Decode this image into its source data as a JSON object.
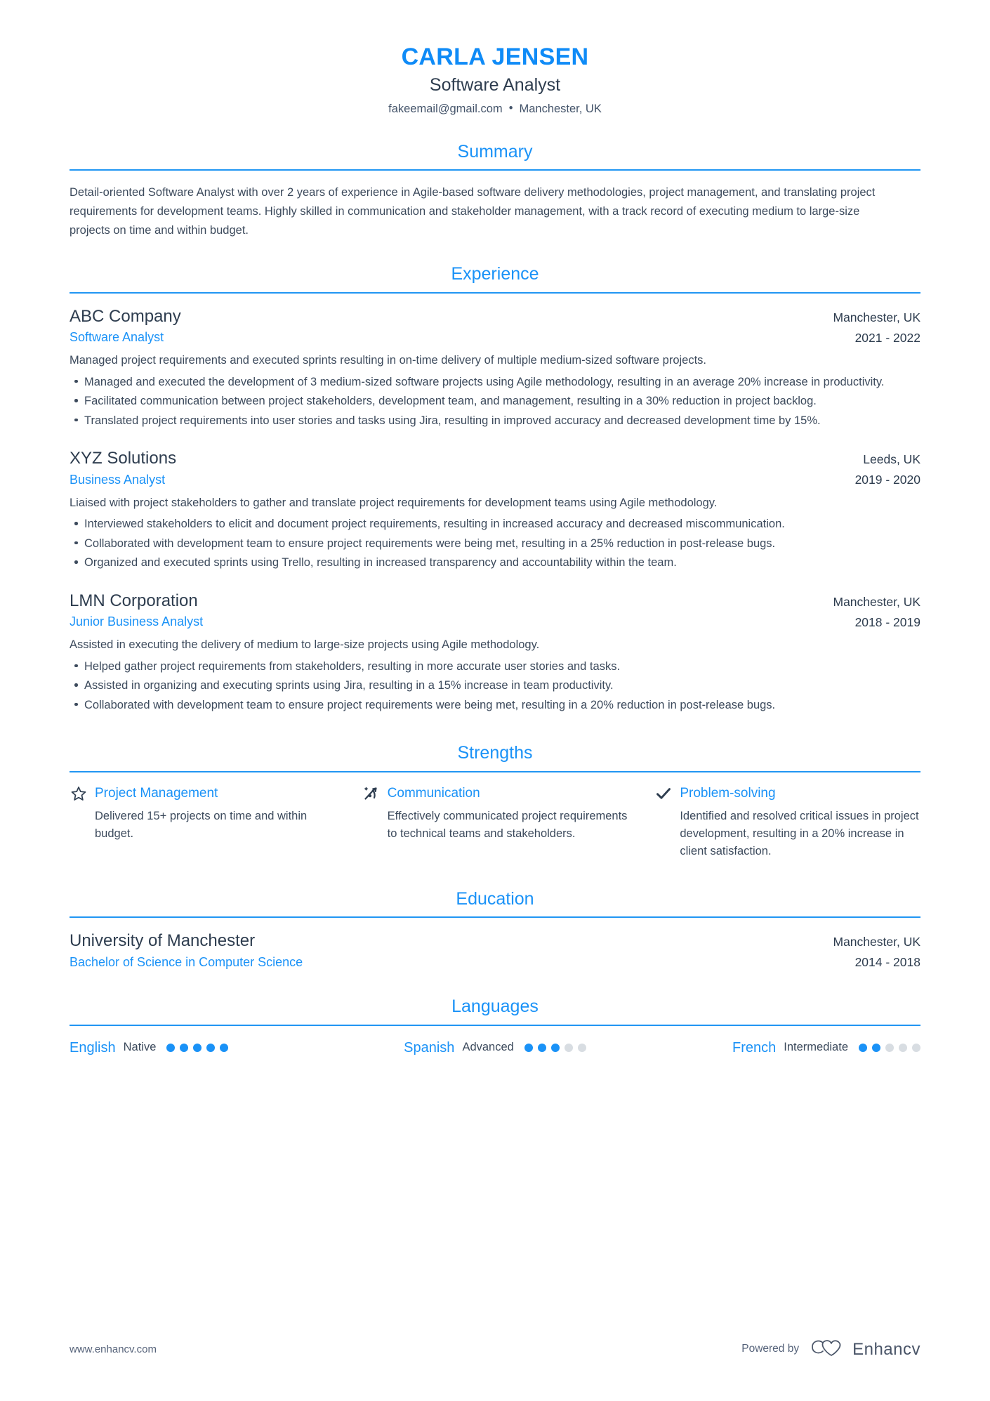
{
  "theme": {
    "accent": "#1a92f7",
    "name_color": "#0f8bf7",
    "text_dark": "#2e3d4f",
    "text_body": "#3c4a5c",
    "rule_color": "#2196f3",
    "dot_empty": "#d8dde2"
  },
  "header": {
    "full_name": "CARLA JENSEN",
    "job_title": "Software Analyst",
    "email": "fakeemail@gmail.com",
    "separator": "•",
    "location": "Manchester, UK"
  },
  "sections": {
    "summary_title": "Summary",
    "experience_title": "Experience",
    "strengths_title": "Strengths",
    "education_title": "Education",
    "languages_title": "Languages"
  },
  "summary": {
    "text": "Detail-oriented Software Analyst with over 2 years of experience in Agile-based software delivery methodologies, project management, and translating project requirements for development teams. Highly skilled in communication and stakeholder management, with a track record of executing medium to large-size projects on time and within budget."
  },
  "experience": [
    {
      "company": "ABC Company",
      "role": "Software Analyst",
      "location": "Manchester, UK",
      "dates": "2021 - 2022",
      "description": "Managed project requirements and executed sprints resulting in on-time delivery of multiple medium-sized software projects.",
      "bullets": [
        "Managed and executed the development of 3 medium-sized software projects using Agile methodology, resulting in an average 20% increase in productivity.",
        "Facilitated communication between project stakeholders, development team, and management, resulting in a 30% reduction in project backlog.",
        "Translated project requirements into user stories and tasks using Jira, resulting in improved accuracy and decreased development time by 15%."
      ]
    },
    {
      "company": "XYZ Solutions",
      "role": "Business Analyst",
      "location": "Leeds, UK",
      "dates": "2019 - 2020",
      "description": "Liaised with project stakeholders to gather and translate project requirements for development teams using Agile methodology.",
      "bullets": [
        "Interviewed stakeholders to elicit and document project requirements, resulting in increased accuracy and decreased miscommunication.",
        "Collaborated with development team to ensure project requirements were being met, resulting in a 25% reduction in post-release bugs.",
        "Organized and executed sprints using Trello, resulting in increased transparency and accountability within the team."
      ]
    },
    {
      "company": "LMN Corporation",
      "role": "Junior Business Analyst",
      "location": "Manchester, UK",
      "dates": "2018 - 2019",
      "description": "Assisted in executing the delivery of medium to large-size projects using Agile methodology.",
      "bullets": [
        "Helped gather project requirements from stakeholders, resulting in more accurate user stories and tasks.",
        "Assisted in organizing and executing sprints using Jira, resulting in a 15% increase in team productivity.",
        "Collaborated with development team to ensure project requirements were being met, resulting in a 20% reduction in post-release bugs."
      ]
    }
  ],
  "strengths": [
    {
      "icon": "star-outline-icon",
      "name": "Project Management",
      "description": "Delivered 15+ projects on time and within budget."
    },
    {
      "icon": "magic-wand-sparkle-icon",
      "name": "Communication",
      "description": "Effectively communicated project requirements to technical teams and stakeholders."
    },
    {
      "icon": "checkmark-icon",
      "name": "Problem-solving",
      "description": "Identified and resolved critical issues in project development, resulting in a 20% increase in client satisfaction."
    }
  ],
  "education": [
    {
      "school": "University of Manchester",
      "degree": "Bachelor of Science in Computer Science",
      "location": "Manchester, UK",
      "dates": "2014 - 2018"
    }
  ],
  "languages": [
    {
      "name": "English",
      "level": "Native",
      "filled": 5,
      "total": 5
    },
    {
      "name": "Spanish",
      "level": "Advanced",
      "filled": 3,
      "total": 5
    },
    {
      "name": "French",
      "level": "Intermediate",
      "filled": 2,
      "total": 5
    }
  ],
  "footer": {
    "url": "www.enhancv.com",
    "powered_by": "Powered by",
    "brand_name": "Enhancv"
  }
}
